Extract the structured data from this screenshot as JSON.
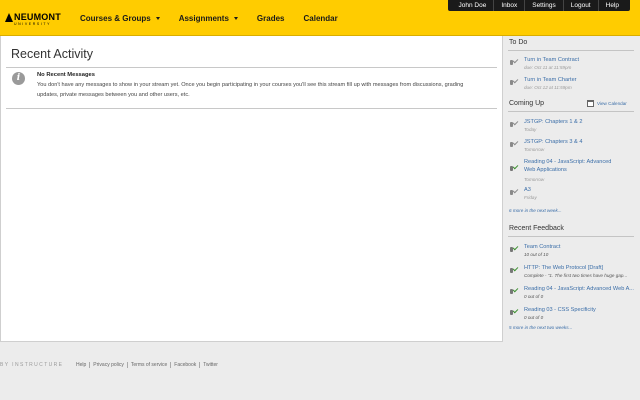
{
  "header": {
    "logo_text": "NEUMONT",
    "logo_sub": "UNIVERSITY",
    "nav": [
      {
        "label": "Courses & Groups",
        "dropdown": true
      },
      {
        "label": "Assignments",
        "dropdown": true
      },
      {
        "label": "Grades",
        "dropdown": false
      },
      {
        "label": "Calendar",
        "dropdown": false
      }
    ],
    "user_links": [
      "John Doe",
      "Inbox",
      "Settings",
      "Logout",
      "Help"
    ],
    "accent": "#ffcc00"
  },
  "main": {
    "title": "Recent Activity",
    "message_title": "No Recent Messages",
    "message_body": "You don't have any messages to show in your stream yet. Once you begin participating in your courses you'll see this stream fill up with messages from discussions, grading updates, private messages between you and other users, etc."
  },
  "sidebar": {
    "todo_heading": "To Do",
    "todo": [
      {
        "title": "Turn in Team Contract",
        "sub": "due: Oct 11 at 11:59pm"
      },
      {
        "title": "Turn in Team Charter",
        "sub": "due: Oct 12 at 11:59pm"
      }
    ],
    "coming_heading": "Coming Up",
    "view_calendar": "View Calendar",
    "coming": [
      {
        "title": "JSTGP: Chapters 1 & 2",
        "sub": "Today"
      },
      {
        "title": "JSTGP: Chapters 3 & 4",
        "sub": "Tomorrow"
      },
      {
        "title": "Reading 04 - JavaScript: Advanced Web Applications",
        "sub": "Tomorrow"
      },
      {
        "title": "A3",
        "sub": "Friday"
      }
    ],
    "coming_more": "6 more in the next week...",
    "feedback_heading": "Recent Feedback",
    "feedback": [
      {
        "title": "Team Contract",
        "sub": "10 out of 10"
      },
      {
        "title": "HTTP: The Web Protocol [Draft]",
        "sub": "Complete - \"1. The first two times have huge gap..."
      },
      {
        "title": "Reading 04 - JavaScript: Advanced Web A...",
        "sub": "0 out of 0"
      },
      {
        "title": "Reading 03 - CSS Specificity",
        "sub": "0 out of 0"
      }
    ],
    "feedback_more": "5 more in the next two weeks..."
  },
  "footer": {
    "brand": "BY INSTRUCTURE",
    "links": [
      "Help",
      "Privacy policy",
      "Terms of service",
      "Facebook",
      "Twitter"
    ]
  }
}
